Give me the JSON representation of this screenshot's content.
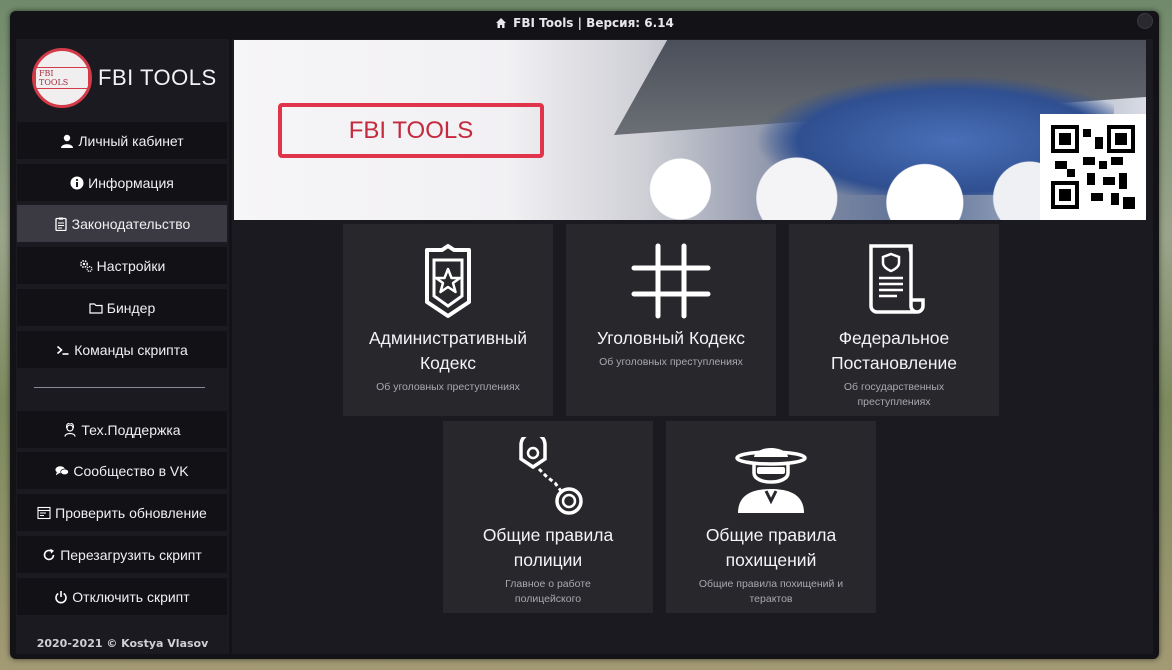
{
  "window": {
    "title": "FBI Tools | Версия: 6.14"
  },
  "sidebar": {
    "logo_badge": "FBI TOOLS",
    "logo_text": "FBI TOOLS",
    "items": [
      {
        "label": "Личный кабинет",
        "icon": "user-icon"
      },
      {
        "label": "Информация",
        "icon": "info-icon"
      },
      {
        "label": "Законодательство",
        "icon": "clipboard-icon",
        "active": true
      },
      {
        "label": "Настройки",
        "icon": "gears-icon"
      },
      {
        "label": "Биндер",
        "icon": "folder-icon"
      },
      {
        "label": "Команды скрипта",
        "icon": "terminal-icon"
      }
    ],
    "items2": [
      {
        "label": "Тех.Поддержка",
        "icon": "support-agent-icon"
      },
      {
        "label": "Сообщество в VK",
        "icon": "chat-icon"
      },
      {
        "label": "Проверить обновление",
        "icon": "window-icon"
      },
      {
        "label": "Перезагрузить скрипт",
        "icon": "reload-icon"
      },
      {
        "label": "Отключить скрипт",
        "icon": "power-icon"
      }
    ],
    "footer": "2020-2021 © Kostya Vlasov"
  },
  "banner": {
    "logo_text": "FBI TOOLS"
  },
  "cards": [
    {
      "title": "Административный Кодекс",
      "desc": "Об уголовных преступлениях",
      "icon": "shield-star-icon"
    },
    {
      "title": "Уголовный Кодекс",
      "desc": "Об уголовных преступлениях",
      "icon": "hashtag-icon"
    },
    {
      "title": "Федеральное Постановление",
      "desc": "Об государственных преступлениях",
      "icon": "scroll-document-icon"
    },
    {
      "title": "Общие правила полиции",
      "desc": "Главное о работе полицейского",
      "icon": "handcuffs-icon"
    },
    {
      "title": "Общие правила похищений",
      "desc": "Общие правила похищений и терактов",
      "icon": "masked-bandit-icon"
    }
  ],
  "colors": {
    "accent": "#d33a48",
    "active_item": "#3b3a42",
    "card_bg": "#28272c"
  }
}
